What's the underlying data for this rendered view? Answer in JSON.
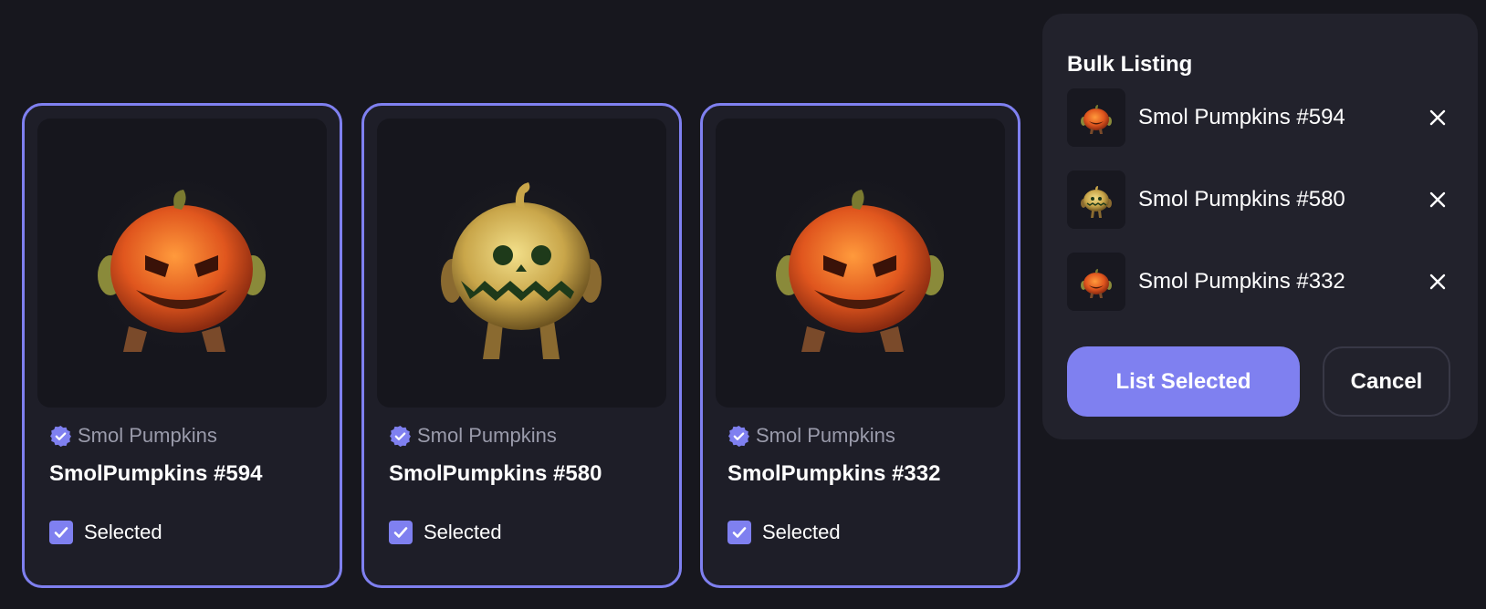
{
  "colors": {
    "accent": "#7f80f0",
    "background": "#17171e",
    "card": "#1e1e28",
    "panel": "#22222c",
    "muted_text": "#9a9bab"
  },
  "cards": [
    {
      "collection": "Smol Pumpkins",
      "title": "SmolPumpkins #594",
      "selected_label": "Selected",
      "art": "orange-pumpkin-image"
    },
    {
      "collection": "Smol Pumpkins",
      "title": "SmolPumpkins #580",
      "selected_label": "Selected",
      "art": "golden-pumpkin-image"
    },
    {
      "collection": "Smol Pumpkins",
      "title": "SmolPumpkins #332",
      "selected_label": "Selected",
      "art": "orange-pumpkin-image"
    }
  ],
  "bulk_listing": {
    "heading": "Bulk Listing",
    "items": [
      {
        "name": "Smol Pumpkins #594"
      },
      {
        "name": "Smol Pumpkins #580"
      },
      {
        "name": "Smol Pumpkins #332"
      }
    ],
    "list_button": "List Selected",
    "cancel_button": "Cancel"
  }
}
